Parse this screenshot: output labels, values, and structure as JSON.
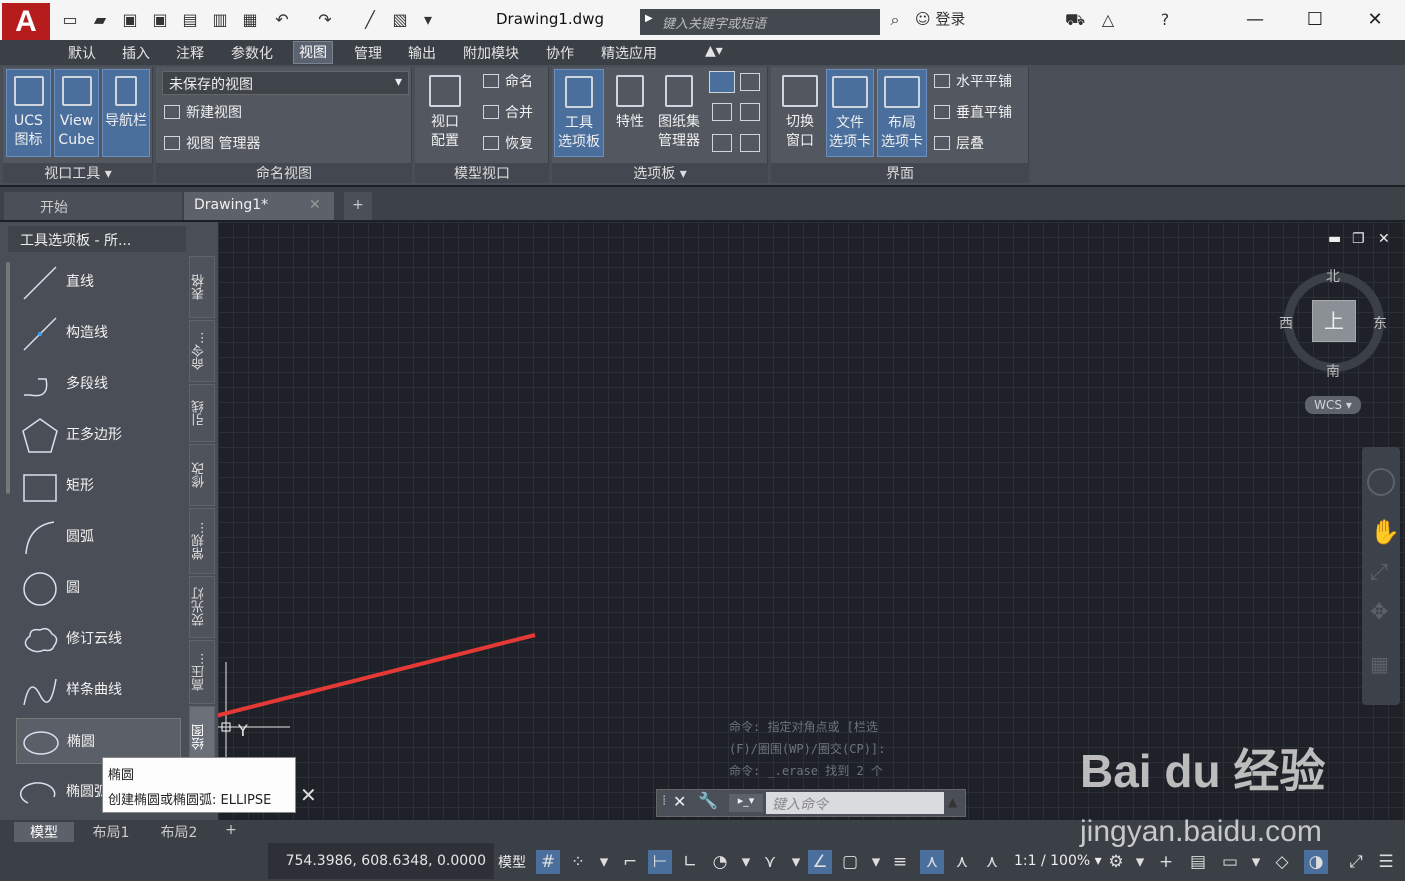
{
  "app": {
    "logo": "A",
    "title": "Drawing1.dwg",
    "search_placeholder": "键入关键字或短语",
    "login": "登录"
  },
  "window": {
    "minimize": "—",
    "maximize": "☐",
    "close": "✕"
  },
  "menus": [
    "默认",
    "插入",
    "注释",
    "参数化",
    "视图",
    "管理",
    "输出",
    "附加模块",
    "协作",
    "精选应用"
  ],
  "ribbon": {
    "ucs": "UCS\n图标",
    "viewcube": "View\nCube",
    "navbar": "导航栏",
    "viewport_tools": "视口工具",
    "unsaved_view": "未保存的视图",
    "new_view": "新建视图",
    "view_manager": "视图 管理器",
    "named_views": "命名视图",
    "viewport_config": "视口\n配置",
    "name": "命名",
    "join": "合并",
    "restore": "恢复",
    "model_viewports": "模型视口",
    "tool_palettes": "工具\n选项板",
    "properties": "特性",
    "sheetset": "图纸集\n管理器",
    "palettes": "选项板",
    "switch_window": "切换\n窗口",
    "file_tabs": "文件\n选项卡",
    "layout_tabs": "布局\n选项卡",
    "tile_h": "水平平铺",
    "tile_v": "垂直平铺",
    "cascade": "层叠",
    "interface": "界面"
  },
  "file_tabs": {
    "start": "开始",
    "drawing": "Drawing1*",
    "add": "+"
  },
  "palette": {
    "title": "工具选项板 - 所...",
    "tools": [
      "直线",
      "构造线",
      "多段线",
      "正多边形",
      "矩形",
      "圆弧",
      "圆",
      "修订云线",
      "样条曲线",
      "椭圆",
      "椭圆弧"
    ],
    "tabs": [
      "表格",
      "命令...",
      "引线",
      "修改",
      "常规...",
      "荧光灯",
      "高压...",
      "绘图"
    ]
  },
  "tooltip": {
    "title": "椭圆",
    "desc": "创建椭圆或椭圆弧: ELLIPSE"
  },
  "viewcube": {
    "n": "北",
    "s": "南",
    "e": "东",
    "w": "西",
    "face": "上",
    "wcs": "WCS"
  },
  "command": {
    "history1": "命令: 指定对角点或 [栏选",
    "history2": "(F)/圈围(WP)/圈交(CP)]:",
    "history3": "命令: _.erase 找到 2 个",
    "placeholder": "键入命令"
  },
  "layouts": [
    "模型",
    "布局1",
    "布局2"
  ],
  "status": {
    "coords": "754.3986, 608.6348, 0.0000",
    "model": "模型",
    "zoom": "1:1 / 100%"
  },
  "watermark": {
    "brand": "Bai du 经验",
    "url": "jingyan.baidu.com"
  }
}
